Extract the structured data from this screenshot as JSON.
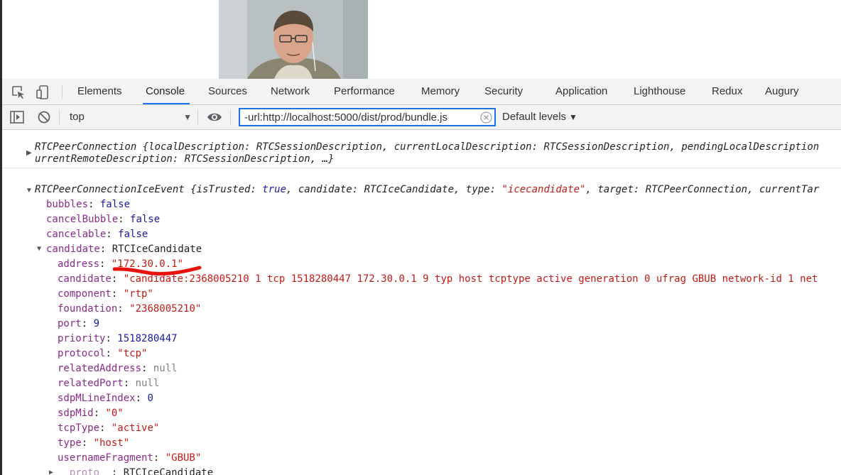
{
  "devtools": {
    "tabs": [
      "Elements",
      "Console",
      "Sources",
      "Network",
      "Performance",
      "Memory",
      "Security",
      "Application",
      "Lighthouse",
      "Redux",
      "Augury"
    ],
    "active_tab": "Console",
    "context": "top",
    "filter_value": "-url:http://localhost:5000/dist/prod/bundle.js",
    "levels_label": "Default levels"
  },
  "console": {
    "peer_connection": {
      "line1": {
        "cls": "RTCPeerConnection",
        "open": " {",
        "k1": "localDescription",
        "v1": "RTCSessionDescription",
        "k2": "currentLocalDescription",
        "v2": "RTCSessionDescription",
        "k3": "pendingLocalDescription"
      },
      "line2": {
        "k1": "urrentRemoteDescription",
        "v1": "RTCSessionDescription",
        "tail": ", …}"
      }
    },
    "ice_event": {
      "header": {
        "cls": "RTCPeerConnectionIceEvent",
        "open": " {",
        "k1": "isTrusted",
        "v1": "true",
        "k2": "candidate",
        "v2": "RTCIceCandidate",
        "k3": "type",
        "v3": "\"icecandidate\"",
        "k4": "target",
        "v4": "RTCPeerConnection",
        "k5": "currentTar"
      },
      "props": [
        {
          "key": "bubbles",
          "value": "false"
        },
        {
          "key": "cancelBubble",
          "value": "false"
        },
        {
          "key": "cancelable",
          "value": "false"
        },
        {
          "key": "candidate",
          "value": "RTCIceCandidate"
        }
      ],
      "candidate_props": [
        {
          "key": "address",
          "value": "\"172.30.0.1\""
        },
        {
          "key": "candidate",
          "value": "\"candidate:2368005210 1 tcp 1518280447 172.30.0.1 9 typ host tcptype active generation 0 ufrag GBUB network-id 1 net"
        },
        {
          "key": "component",
          "value": "\"rtp\""
        },
        {
          "key": "foundation",
          "value": "\"2368005210\""
        },
        {
          "key": "port",
          "value": "9"
        },
        {
          "key": "priority",
          "value": "1518280447"
        },
        {
          "key": "protocol",
          "value": "\"tcp\""
        },
        {
          "key": "relatedAddress",
          "value": "null"
        },
        {
          "key": "relatedPort",
          "value": "null"
        },
        {
          "key": "sdpMLineIndex",
          "value": "0"
        },
        {
          "key": "sdpMid",
          "value": "\"0\""
        },
        {
          "key": "tcpType",
          "value": "\"active\""
        },
        {
          "key": "type",
          "value": "\"host\""
        },
        {
          "key": "usernameFragment",
          "value": "\"GBUB\""
        },
        {
          "key": "__proto__",
          "value": "RTCIceCandidate"
        }
      ]
    }
  },
  "colors": {
    "accent": "#1a73e8",
    "key": "#8a2a8a",
    "string": "#c41a16",
    "number": "#1a1aa6",
    "null": "#808080",
    "redaction": "#e8120c"
  }
}
